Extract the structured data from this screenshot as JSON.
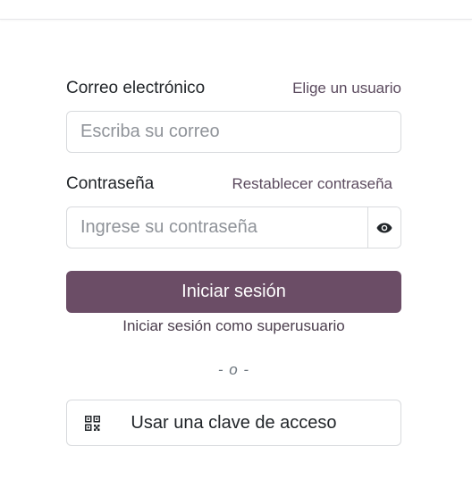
{
  "email": {
    "label": "Correo electrónico",
    "link": "Elige un usuario",
    "placeholder": "Escriba su correo"
  },
  "password": {
    "label": "Contraseña",
    "link": "Restablecer contraseña",
    "placeholder": "Ingrese su contraseña",
    "toggle_icon": "eye-icon"
  },
  "login_button": "Iniciar sesión",
  "superuser_link": "Iniciar sesión como superusuario",
  "divider": "- o -",
  "passkey": {
    "icon": "qr-code-icon",
    "label": "Usar una clave de acceso"
  },
  "colors": {
    "primary": "#6b4d66",
    "link": "#5b4a5e"
  }
}
